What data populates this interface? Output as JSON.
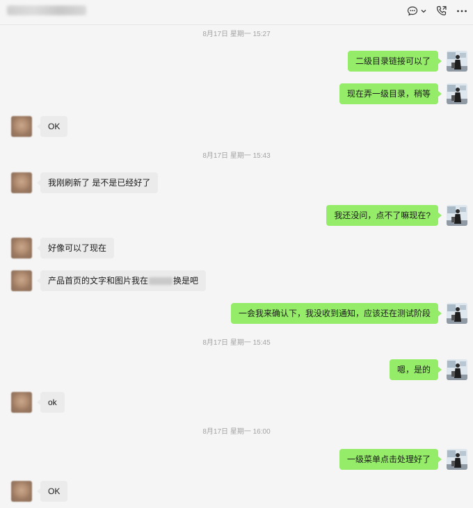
{
  "header": {
    "contact_name": "",
    "icons": [
      "chat-bubble-icon",
      "chevron-down-icon",
      "phone-call-icon",
      "more-icon"
    ]
  },
  "messages": [
    {
      "type": "timestamp",
      "text": "8月17日 星期一 15:27"
    },
    {
      "type": "msg",
      "side": "right",
      "text": "二级目录链接可以了"
    },
    {
      "type": "msg",
      "side": "right",
      "text": "现在弄一级目录，稍等"
    },
    {
      "type": "msg",
      "side": "left",
      "text": "OK"
    },
    {
      "type": "timestamp",
      "text": "8月17日 星期一 15:43"
    },
    {
      "type": "msg",
      "side": "left",
      "text": "我刚刷新了 是不是已经好了"
    },
    {
      "type": "msg",
      "side": "right",
      "text": "我还没问，点不了嘛现在?"
    },
    {
      "type": "msg",
      "side": "left",
      "text": "好像可以了现在"
    },
    {
      "type": "msg",
      "side": "left",
      "text_before": "产品首页的文字和图片我在",
      "text_after": "换是吧"
    },
    {
      "type": "msg",
      "side": "right",
      "text": "一会我来确认下，我没收到通知，应该还在测试阶段"
    },
    {
      "type": "timestamp",
      "text": "8月17日 星期一 15:45"
    },
    {
      "type": "msg",
      "side": "right",
      "text": "嗯，是的"
    },
    {
      "type": "msg",
      "side": "left",
      "text": "ok"
    },
    {
      "type": "timestamp",
      "text": "8月17日 星期一 16:00"
    },
    {
      "type": "msg",
      "side": "right",
      "text": "一级菜单点击处理好了"
    },
    {
      "type": "msg",
      "side": "left",
      "text": "OK"
    }
  ],
  "colors": {
    "sent_bubble": "#95ec69",
    "received_bubble": "#ebebeb",
    "background": "#f5f5f5",
    "timestamp": "#a3a3a3"
  }
}
